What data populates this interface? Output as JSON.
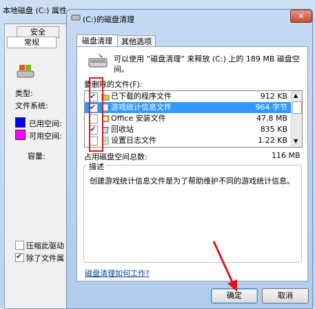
{
  "background_window": {
    "title": "本地磁盘 (C:) 属性",
    "tabs": [
      "安全",
      "常规"
    ],
    "labels": {
      "type": "类型:",
      "filesystem": "文件系统:",
      "used": "已用空间:",
      "free": "可用空间:",
      "capacity": "容量:"
    },
    "checkboxes": [
      {
        "label": "压缩此驱动",
        "checked": false
      },
      {
        "label": "除了文件属",
        "checked": true
      }
    ],
    "colors": {
      "used": "#0000ff",
      "free": "#ff00ff"
    }
  },
  "dialog": {
    "title": "(C:)的磁盘清理",
    "close_label": "✕",
    "tabs": [
      "磁盘清理",
      "其他选项"
    ],
    "info_text": "可以使用 “磁盘清理” 来释放  (C:) 上的 189 MB 磁盘空间。",
    "files_label": "要删除的文件(F):",
    "files": [
      {
        "name": "已下载的程序文件",
        "size": "912 KB",
        "checked": true,
        "selected": false,
        "icon": "folder-icon"
      },
      {
        "name": "游戏统计信息文件",
        "size": "964 字节",
        "checked": true,
        "selected": true,
        "icon": "file-icon"
      },
      {
        "name": "Office 安装文件",
        "size": "47.8 MB",
        "checked": false,
        "selected": false,
        "icon": "office-icon"
      },
      {
        "name": "回收站",
        "size": "835 KB",
        "checked": true,
        "selected": false,
        "icon": "recycle-bin-icon"
      },
      {
        "name": "设置日志文件",
        "size": "1.22 KB",
        "checked": false,
        "selected": false,
        "icon": "log-file-icon"
      }
    ],
    "total_label": "占用磁盘空间总数:",
    "total_value": "116 MB",
    "description_title": "描述",
    "description_text": "创建游戏统计信息文件是为了帮助维护不同的游戏统计信息。",
    "help_link": "磁盘清理如何工作?",
    "ok_label": "确定",
    "cancel_label": "取消",
    "highlight_color": "#e11515"
  }
}
